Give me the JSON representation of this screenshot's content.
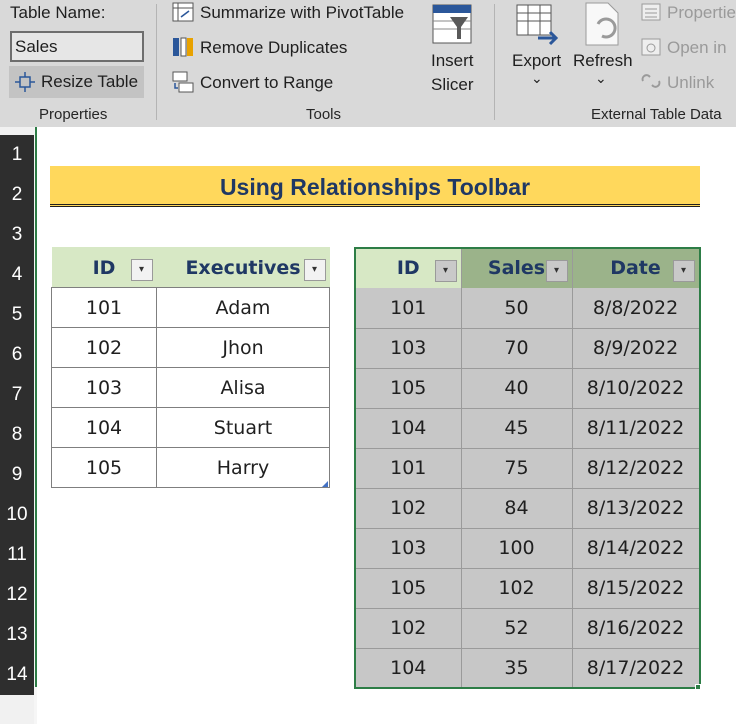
{
  "ribbon": {
    "properties": {
      "table_name_label": "Table Name:",
      "table_name_value": "Sales",
      "resize_table_label": "Resize Table",
      "group_label": "Properties"
    },
    "tools": {
      "summarize_label": "Summarize with PivotTable",
      "remove_duplicates_label": "Remove Duplicates",
      "convert_to_range_label": "Convert to Range",
      "insert_slicer_line1": "Insert",
      "insert_slicer_line2": "Slicer",
      "group_label": "Tools"
    },
    "external": {
      "export_label": "Export",
      "refresh_label": "Refresh",
      "properties_label": "Propertie",
      "open_in_label": "Open in",
      "unlink_label": "Unlink",
      "group_label": "External Table Data",
      "dropdown_glyph": "⌄"
    }
  },
  "row_numbers": [
    "1",
    "2",
    "3",
    "4",
    "5",
    "6",
    "7",
    "8",
    "9",
    "10",
    "11",
    "12",
    "13",
    "14"
  ],
  "title": "Using Relationships Toolbar",
  "executives_table": {
    "headers": [
      "ID",
      "Executives"
    ],
    "rows": [
      [
        "101",
        "Adam"
      ],
      [
        "102",
        "Jhon"
      ],
      [
        "103",
        "Alisa"
      ],
      [
        "104",
        "Stuart"
      ],
      [
        "105",
        "Harry"
      ]
    ]
  },
  "sales_table": {
    "headers": [
      "ID",
      "Sales",
      "Date"
    ],
    "rows": [
      [
        "101",
        "50",
        "8/8/2022"
      ],
      [
        "103",
        "70",
        "8/9/2022"
      ],
      [
        "105",
        "40",
        "8/10/2022"
      ],
      [
        "104",
        "45",
        "8/11/2022"
      ],
      [
        "101",
        "75",
        "8/12/2022"
      ],
      [
        "102",
        "84",
        "8/13/2022"
      ],
      [
        "103",
        "100",
        "8/14/2022"
      ],
      [
        "105",
        "102",
        "8/15/2022"
      ],
      [
        "102",
        "52",
        "8/16/2022"
      ],
      [
        "104",
        "35",
        "8/17/2022"
      ]
    ]
  },
  "filter_glyph": "▾",
  "colors": {
    "title_fill": "#ffd85c",
    "title_text": "#1f3864",
    "header_fill": "#d7e8c5",
    "selected_header_fill": "#9bb38a",
    "selection_border": "#2d7d46",
    "selected_cell_fill": "#c7c7c7"
  }
}
